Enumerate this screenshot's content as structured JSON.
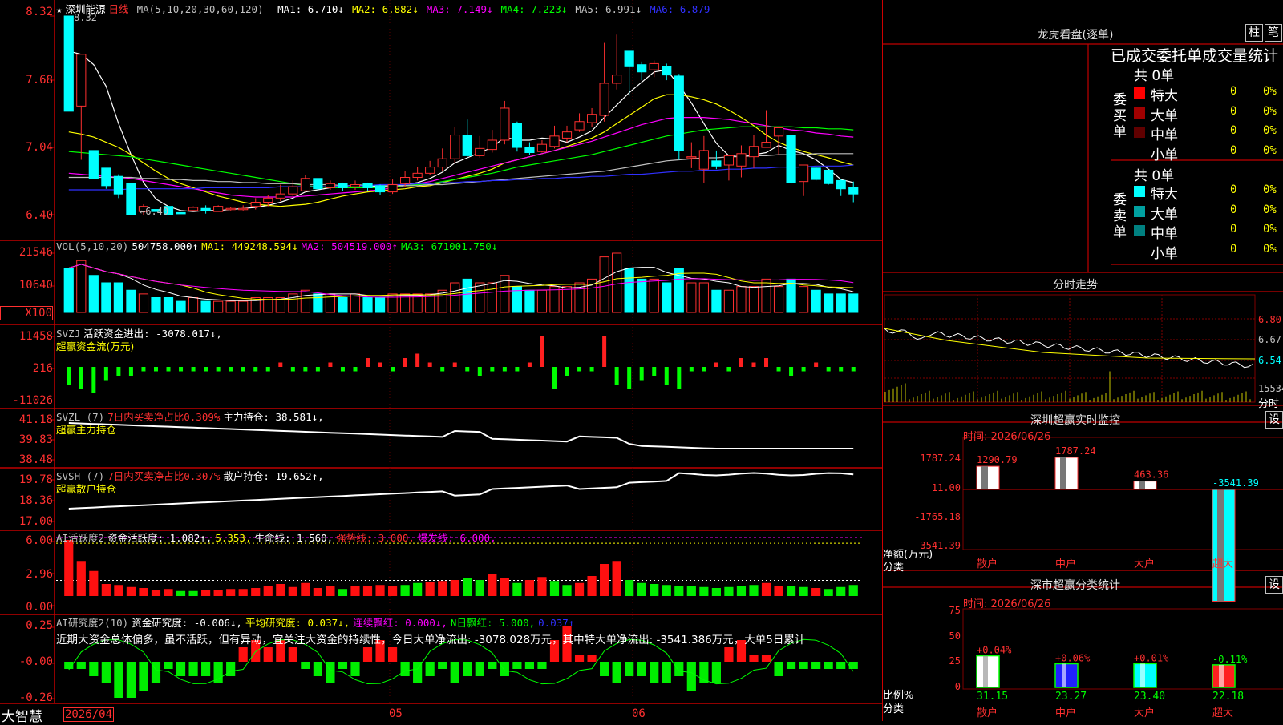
{
  "stock": {
    "name": "深圳能源",
    "period": "日线",
    "star": "★"
  },
  "main_header": {
    "ma_spec": "MA(5,10,20,30,60,120)",
    "items": [
      {
        "label": "MA1:",
        "value": "6.710↓",
        "color": "#ffffff"
      },
      {
        "label": "MA2:",
        "value": "6.882↓",
        "color": "#ffff00"
      },
      {
        "label": "MA3:",
        "value": "7.149↓",
        "color": "#ff00ff"
      },
      {
        "label": "MA4:",
        "value": "7.223↓",
        "color": "#00ff00"
      },
      {
        "label": "MA5:",
        "value": "6.991↓",
        "color": "#c0c0c0"
      },
      {
        "label": "MA6:",
        "value": "6.879",
        "color": "#3030ff"
      }
    ],
    "high_marker": "8.32",
    "low_marker": "←6.40"
  },
  "price_axis": [
    "8.32",
    "7.68",
    "7.04",
    "6.40"
  ],
  "vol": {
    "spec": "VOL(5,10,20)",
    "value": "504758.000↑",
    "ma1": "MA1: 449248.594↓",
    "ma2": "MA2: 504519.000↑",
    "ma3": "MA3: 671001.750↓",
    "axis": [
      "21546",
      "10640"
    ],
    "unit": "X100"
  },
  "svzj": {
    "spec": "SVZJ",
    "label": "活跃资金进出: -3078.017↓,",
    "sub": "超赢资金流(万元)",
    "axis": [
      "11458",
      "216",
      "-11026"
    ]
  },
  "svzl": {
    "spec": "SVZL (7)",
    "ratio": "7日内买卖净占比0.309%",
    "hold": "主力持仓: 38.581↓,",
    "sub": "超赢主力持仓",
    "axis": [
      "41.18",
      "39.83",
      "38.48"
    ]
  },
  "svsh": {
    "spec": "SVSH (7)",
    "ratio": "7日内买卖净占比0.307%",
    "hold": "散户持仓: 19.652↑,",
    "sub": "超赢散户持仓",
    "axis": [
      "19.78",
      "18.36",
      "17.00"
    ]
  },
  "ai_active": {
    "spec": "AI活跃度2",
    "l1": "资金活跃度: 1.082↑,",
    "l2": "5.353,",
    "l3": "生命线: 1.560,",
    "l4": "强势线: 3.000,",
    "l5": "爆发线: 6.000,",
    "axis": [
      "6.00",
      "2.96",
      "0.00"
    ]
  },
  "ai_research": {
    "spec": "AI研究度2(10)",
    "l1": "资金研究度: -0.006↓,",
    "l2": "平均研究度: 0.037↓,",
    "l3": "连续飘红: 0.000↓,",
    "l4": "N日飘红: 5.000,",
    "l5": "0.037↑",
    "note": "近期大资金总体偏多，虽不活跃，但有异动，宜关注大资金的持续性，今日大单净流出: -3078.028万元，其中特大单净流出: -3541.386万元，大单5日累计",
    "axis": [
      "0.25",
      "-0.00",
      "-0.26"
    ]
  },
  "bottom": {
    "brand": "大智慧",
    "date": "2026/04",
    "m05": "05",
    "m06": "06"
  },
  "right": {
    "lhb_title": "龙虎看盘(逐单)",
    "btn1": "柱",
    "btn2": "笔",
    "stat_title": "已成交委托单成交量统计",
    "buy_label": "委买单",
    "sell_label": "委卖单",
    "buy_total": "共 0单",
    "sell_total": "共 0单",
    "buy_rows": [
      {
        "name": "特大",
        "n": "0",
        "p": "0%",
        "color": "#ff0000"
      },
      {
        "name": "大单",
        "n": "0",
        "p": "0%",
        "color": "#a00000"
      },
      {
        "name": "中单",
        "n": "0",
        "p": "0%",
        "color": "#600000"
      },
      {
        "name": "小单",
        "n": "0",
        "p": "0%",
        "color": ""
      }
    ],
    "sell_rows": [
      {
        "name": "特大",
        "n": "0",
        "p": "0%",
        "color": "#00ffff"
      },
      {
        "name": "大单",
        "n": "0",
        "p": "0%",
        "color": "#00a0a0"
      },
      {
        "name": "中单",
        "n": "0",
        "p": "0%",
        "color": "#008080"
      },
      {
        "name": "小单",
        "n": "0",
        "p": "0%",
        "color": ""
      }
    ],
    "fs_title": "分时走势",
    "fs_axis": [
      "6.80",
      "6.67",
      "6.54"
    ],
    "fs_vol": "15534",
    "fs_label": "分时",
    "mon_title": "深圳超赢实时监控",
    "mon_btn": "设",
    "mon_time": "时间: 2026/06/26",
    "mon_axis": [
      "1787.24",
      "11.00",
      "-1765.18",
      "-3541.39"
    ],
    "mon_ylabel": "净额(万元)",
    "mon_xlabel": "分类",
    "mon_bars": [
      {
        "cat": "散户",
        "value": 1290.79,
        "label": "1290.79"
      },
      {
        "cat": "中户",
        "value": 1787.24,
        "label": "1787.24"
      },
      {
        "cat": "大户",
        "value": 463.36,
        "label": "463.36"
      },
      {
        "cat": "超大",
        "value": -3541.39,
        "label": "-3541.39"
      }
    ],
    "cls_title": "深市超赢分类统计",
    "cls_btn": "设",
    "cls_time": "时间: 2026/06/26",
    "cls_axis": [
      "75",
      "50",
      "25",
      "0"
    ],
    "cls_ylabel": "比例%",
    "cls_xlabel": "分类",
    "cls_bars": [
      {
        "cat": "散户",
        "value": 31.15,
        "label": "31.15",
        "chg": "+0.04%"
      },
      {
        "cat": "中户",
        "value": 23.27,
        "label": "23.27",
        "chg": "+0.06%"
      },
      {
        "cat": "大户",
        "value": 23.4,
        "label": "23.40",
        "chg": "+0.01%"
      },
      {
        "cat": "超大",
        "value": 22.18,
        "label": "22.18",
        "chg": "-0.11%"
      }
    ]
  },
  "chart_data": {
    "type": "candlestick",
    "title": "深圳能源 日线",
    "ylim": [
      6.3,
      8.32
    ],
    "candles": [
      [
        8.32,
        7.4,
        8.32,
        7.4
      ],
      [
        7.45,
        7.95,
        7.95,
        6.93
      ],
      [
        7.02,
        6.75,
        7.02,
        6.75
      ],
      [
        6.85,
        6.68,
        6.85,
        6.65
      ],
      [
        6.77,
        6.6,
        6.79,
        6.56
      ],
      [
        6.7,
        6.4,
        6.7,
        6.4
      ],
      [
        6.43,
        6.48,
        6.5,
        6.4
      ],
      [
        6.45,
        6.43,
        6.45,
        6.4
      ],
      [
        6.48,
        6.4,
        6.48,
        6.4
      ],
      [
        6.42,
        6.41,
        6.42,
        6.41
      ],
      [
        6.44,
        6.47,
        6.48,
        6.43
      ],
      [
        6.46,
        6.44,
        6.49,
        6.41
      ],
      [
        6.43,
        6.48,
        6.49,
        6.43
      ],
      [
        6.46,
        6.46,
        6.47,
        6.44
      ],
      [
        6.46,
        6.46,
        6.49,
        6.44
      ],
      [
        6.48,
        6.52,
        6.56,
        6.45
      ],
      [
        6.52,
        6.56,
        6.59,
        6.48
      ],
      [
        6.56,
        6.6,
        6.69,
        6.53
      ],
      [
        6.6,
        6.67,
        6.73,
        6.57
      ],
      [
        6.63,
        6.75,
        6.78,
        6.62
      ],
      [
        6.75,
        6.65,
        6.75,
        6.63
      ],
      [
        6.66,
        6.7,
        6.73,
        6.64
      ],
      [
        6.7,
        6.66,
        6.71,
        6.63
      ],
      [
        6.67,
        6.69,
        6.73,
        6.64
      ],
      [
        6.7,
        6.66,
        6.71,
        6.63
      ],
      [
        6.68,
        6.62,
        6.69,
        6.59
      ],
      [
        6.62,
        6.69,
        6.74,
        6.6
      ],
      [
        6.7,
        6.76,
        6.82,
        6.67
      ],
      [
        6.76,
        6.8,
        6.86,
        6.73
      ],
      [
        6.8,
        6.86,
        6.92,
        6.78
      ],
      [
        6.86,
        6.94,
        7.04,
        6.82
      ],
      [
        6.94,
        7.17,
        7.25,
        6.9
      ],
      [
        7.17,
        6.97,
        7.32,
        6.95
      ],
      [
        6.97,
        7.04,
        7.16,
        6.95
      ],
      [
        7.03,
        7.12,
        7.22,
        7.0
      ],
      [
        7.12,
        7.43,
        7.5,
        7.08
      ],
      [
        7.28,
        7.05,
        7.3,
        7.01
      ],
      [
        7.05,
        7.0,
        7.1,
        6.98
      ],
      [
        7.01,
        7.08,
        7.12,
        7.0
      ],
      [
        7.06,
        7.16,
        7.26,
        7.04
      ],
      [
        7.14,
        7.2,
        7.26,
        7.1
      ],
      [
        7.22,
        7.3,
        7.38,
        7.2
      ],
      [
        7.29,
        7.37,
        7.43,
        7.25
      ],
      [
        7.36,
        7.67,
        8.06,
        7.3
      ],
      [
        7.67,
        7.75,
        8.14,
        7.61
      ],
      [
        7.98,
        7.83,
        7.98,
        7.55
      ],
      [
        7.85,
        7.78,
        7.88,
        7.7
      ],
      [
        7.8,
        7.86,
        7.89,
        7.73
      ],
      [
        7.83,
        7.75,
        7.86,
        7.7
      ],
      [
        7.74,
        7.02,
        7.76,
        6.93
      ],
      [
        6.95,
        6.96,
        7.1,
        6.85
      ],
      [
        6.84,
        7.02,
        7.16,
        6.71
      ],
      [
        6.92,
        6.87,
        7.02,
        6.84
      ],
      [
        6.88,
        6.97,
        6.98,
        6.73
      ],
      [
        6.87,
        6.99,
        7.07,
        6.76
      ],
      [
        6.96,
        7.06,
        7.17,
        6.85
      ],
      [
        7.05,
        7.1,
        7.41,
        7.05
      ],
      [
        7.16,
        7.24,
        7.24,
        6.98
      ],
      [
        7.17,
        6.71,
        7.17,
        6.7
      ],
      [
        6.72,
        6.88,
        6.88,
        6.58
      ],
      [
        6.85,
        6.74,
        6.86,
        6.73
      ],
      [
        6.83,
        6.7,
        6.83,
        6.69
      ],
      [
        6.73,
        6.65,
        6.74,
        6.58
      ],
      [
        6.66,
        6.6,
        6.72,
        6.52
      ]
    ],
    "ma": [
      {
        "name": "MA1",
        "color": "#ffffff",
        "values": [
          7.98,
          7.95,
          7.85,
          7.64,
          7.28,
          6.98,
          6.71,
          6.55,
          6.48,
          6.44,
          6.43,
          6.44,
          6.44,
          6.45,
          6.46,
          6.47,
          6.49,
          6.52,
          6.56,
          6.62,
          6.64,
          6.66,
          6.67,
          6.69,
          6.68,
          6.67,
          6.67,
          6.69,
          6.71,
          6.75,
          6.81,
          6.9,
          6.95,
          7.0,
          7.05,
          7.15,
          7.12,
          7.12,
          7.14,
          7.13,
          7.1,
          7.15,
          7.21,
          7.34,
          7.46,
          7.58,
          7.68,
          7.78,
          7.8,
          7.65,
          7.48,
          7.28,
          7.09,
          6.97,
          6.96,
          6.98,
          7.0,
          7.07,
          7.02,
          6.99,
          6.93,
          6.84,
          6.74,
          6.71
        ]
      },
      {
        "name": "MA2",
        "color": "#ffff00",
        "values": [
          7.2,
          7.18,
          7.15,
          7.1,
          7.05,
          6.98,
          6.9,
          6.82,
          6.75,
          6.7,
          6.66,
          6.62,
          6.58,
          6.55,
          6.52,
          6.5,
          6.49,
          6.48,
          6.49,
          6.5,
          6.52,
          6.55,
          6.58,
          6.6,
          6.62,
          6.63,
          6.64,
          6.65,
          6.67,
          6.68,
          6.71,
          6.74,
          6.77,
          6.8,
          6.84,
          6.9,
          6.93,
          6.96,
          6.99,
          7.02,
          7.06,
          7.1,
          7.14,
          7.2,
          7.28,
          7.36,
          7.44,
          7.52,
          7.56,
          7.56,
          7.54,
          7.51,
          7.47,
          7.41,
          7.34,
          7.26,
          7.17,
          7.1,
          7.05,
          7.01,
          6.98,
          6.95,
          6.91,
          6.88
        ]
      },
      {
        "name": "MA3",
        "color": "#ff00ff",
        "values": [
          6.8,
          6.79,
          6.78,
          6.77,
          6.76,
          6.75,
          6.73,
          6.71,
          6.69,
          6.67,
          6.65,
          6.63,
          6.61,
          6.59,
          6.58,
          6.57,
          6.57,
          6.57,
          6.57,
          6.58,
          6.59,
          6.6,
          6.61,
          6.62,
          6.63,
          6.64,
          6.66,
          6.68,
          6.7,
          6.72,
          6.75,
          6.78,
          6.81,
          6.84,
          6.87,
          6.9,
          6.93,
          6.96,
          6.99,
          7.02,
          7.05,
          7.08,
          7.11,
          7.15,
          7.19,
          7.23,
          7.27,
          7.3,
          7.33,
          7.34,
          7.34,
          7.34,
          7.33,
          7.32,
          7.3,
          7.28,
          7.26,
          7.24,
          7.22,
          7.21,
          7.19,
          7.18,
          7.16,
          7.15
        ]
      },
      {
        "name": "MA4",
        "color": "#00ff00",
        "values": [
          7.01,
          7.0,
          6.99,
          6.98,
          6.97,
          6.96,
          6.94,
          6.92,
          6.9,
          6.88,
          6.86,
          6.84,
          6.82,
          6.8,
          6.78,
          6.76,
          6.74,
          6.72,
          6.7,
          6.68,
          6.67,
          6.66,
          6.66,
          6.66,
          6.66,
          6.66,
          6.67,
          6.68,
          6.69,
          6.7,
          6.72,
          6.74,
          6.76,
          6.78,
          6.8,
          6.83,
          6.86,
          6.88,
          6.9,
          6.92,
          6.94,
          6.96,
          6.98,
          7.01,
          7.04,
          7.07,
          7.1,
          7.13,
          7.16,
          7.18,
          7.2,
          7.22,
          7.23,
          7.24,
          7.25,
          7.25,
          7.25,
          7.25,
          7.25,
          7.24,
          7.24,
          7.23,
          7.23,
          7.22
        ]
      },
      {
        "name": "MA5",
        "color": "#c0c0c0",
        "values": [
          6.76,
          6.76,
          6.76,
          6.76,
          6.76,
          6.76,
          6.75,
          6.75,
          6.74,
          6.74,
          6.73,
          6.73,
          6.72,
          6.72,
          6.71,
          6.71,
          6.7,
          6.7,
          6.7,
          6.69,
          6.69,
          6.69,
          6.68,
          6.68,
          6.68,
          6.68,
          6.68,
          6.68,
          6.68,
          6.69,
          6.69,
          6.7,
          6.71,
          6.72,
          6.73,
          6.74,
          6.75,
          6.76,
          6.77,
          6.78,
          6.79,
          6.8,
          6.81,
          6.82,
          6.84,
          6.86,
          6.88,
          6.9,
          6.92,
          6.93,
          6.94,
          6.95,
          6.95,
          6.96,
          6.96,
          6.97,
          6.97,
          6.98,
          6.98,
          6.98,
          6.99,
          6.99,
          6.99,
          6.99
        ]
      },
      {
        "name": "MA6",
        "color": "#3030ff",
        "values": [
          6.64,
          6.64,
          6.64,
          6.64,
          6.64,
          6.65,
          6.65,
          6.65,
          6.65,
          6.65,
          6.65,
          6.66,
          6.66,
          6.66,
          6.66,
          6.66,
          6.66,
          6.67,
          6.67,
          6.67,
          6.67,
          6.67,
          6.68,
          6.68,
          6.68,
          6.69,
          6.69,
          6.69,
          6.7,
          6.7,
          6.71,
          6.71,
          6.72,
          6.72,
          6.73,
          6.73,
          6.74,
          6.74,
          6.75,
          6.75,
          6.76,
          6.76,
          6.77,
          6.77,
          6.78,
          6.79,
          6.79,
          6.8,
          6.81,
          6.82,
          6.82,
          6.83,
          6.83,
          6.84,
          6.84,
          6.85,
          6.85,
          6.86,
          6.86,
          6.86,
          6.87,
          6.87,
          6.87,
          6.88
        ]
      }
    ],
    "volume": [
      12,
      14,
      10,
      8,
      8,
      6,
      5,
      4,
      4,
      3,
      4,
      3,
      3,
      3,
      3,
      4,
      4,
      4,
      5,
      6,
      5,
      5,
      4,
      5,
      4,
      4,
      5,
      5,
      5,
      5,
      6,
      8,
      9,
      8,
      8,
      10,
      7,
      6,
      6,
      7,
      7,
      8,
      9,
      15,
      16,
      12,
      9,
      9,
      8,
      12,
      8,
      8,
      6,
      6,
      7,
      7,
      9,
      7,
      9,
      7,
      6,
      5,
      5,
      5
    ],
    "zj": [
      -4,
      -5,
      -6,
      -3,
      -2,
      -2,
      -1,
      -1,
      -1,
      -1,
      -1,
      -1,
      -1,
      -1,
      -1,
      -1,
      -1,
      1,
      -1,
      -1,
      -1,
      1,
      -1,
      -1,
      2,
      1,
      -1,
      2,
      3,
      1,
      -1,
      1,
      -1,
      -2,
      -1,
      -1,
      -1,
      1,
      7,
      -5,
      -2,
      -1,
      -1,
      7,
      -4,
      -5,
      -3,
      -2,
      -4,
      -5,
      -1,
      -1,
      1,
      -1,
      2,
      1,
      2,
      -1,
      -2,
      -1,
      1,
      -1,
      -1,
      -1
    ],
    "ai_bars": [
      5.6,
      3.5,
      2.5,
      1.2,
      1.1,
      0.9,
      0.8,
      0.6,
      0.7,
      0.5,
      0.5,
      0.6,
      0.6,
      0.7,
      0.7,
      0.8,
      1.0,
      1.2,
      0.9,
      1.3,
      0.8,
      1.0,
      0.7,
      1.0,
      1.0,
      1.1,
      1.0,
      1.1,
      1.3,
      1.4,
      1.5,
      1.6,
      1.8,
      1.6,
      2.2,
      1.8,
      1.3,
      1.6,
      1.9,
      1.5,
      1.1,
      1.3,
      2.0,
      3.2,
      3.5,
      1.6,
      1.3,
      1.2,
      1.1,
      1.0,
      1.0,
      0.9,
      0.8,
      0.9,
      1.0,
      1.1,
      1.3,
      1.0,
      1.0,
      0.9,
      0.8,
      0.7,
      0.9,
      1.1
    ],
    "ai_up": [
      1,
      1,
      1,
      1,
      1,
      1,
      1,
      1,
      1,
      0,
      0,
      1,
      1,
      1,
      1,
      1,
      1,
      1,
      1,
      1,
      1,
      1,
      0,
      1,
      1,
      1,
      1,
      0,
      0,
      1,
      1,
      1,
      0,
      0,
      1,
      1,
      0,
      1,
      1,
      0,
      0,
      1,
      1,
      1,
      1,
      0,
      0,
      0,
      0,
      0,
      0,
      0,
      0,
      0,
      0,
      0,
      1,
      1,
      0,
      0,
      1,
      0,
      0,
      0
    ],
    "research": [
      -0.01,
      -0.01,
      -0.02,
      -0.03,
      -0.05,
      -0.05,
      -0.04,
      -0.03,
      -0.01,
      -0.02,
      -0.02,
      -0.02,
      -0.03,
      -0.02,
      0.02,
      0.03,
      0.02,
      0.03,
      0.02,
      -0.01,
      -0.02,
      -0.03,
      -0.01,
      -0.02,
      0.02,
      0.03,
      0.02,
      -0.02,
      -0.03,
      -0.02,
      -0.01,
      -0.03,
      -0.02,
      -0.02,
      -0.01,
      -0.02,
      -0.01,
      -0.01,
      -0.01,
      0.03,
      0.05,
      0.01,
      0.01,
      -0.02,
      -0.03,
      -0.02,
      -0.02,
      -0.03,
      -0.03,
      -0.02,
      -0.04,
      -0.03,
      -0.03,
      0.02,
      0.03,
      0.01,
      0.01,
      -0.02,
      -0.01,
      -0.01,
      -0.01,
      -0.01,
      -0.01,
      -0.01
    ]
  }
}
